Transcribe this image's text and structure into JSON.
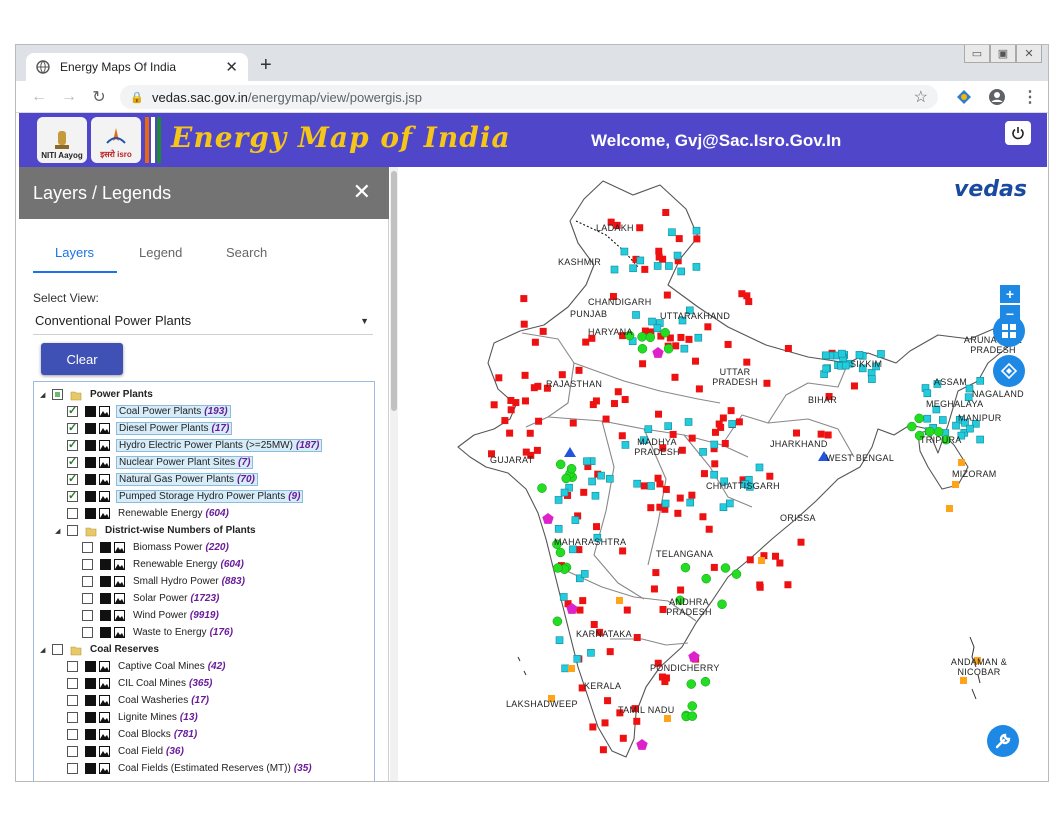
{
  "browser": {
    "tab_title": "Energy Maps Of India",
    "url_host": "vedas.sac.gov.in",
    "url_path": "/energymap/view/powergis.jsp"
  },
  "header": {
    "logo1_label": "NITI Aayog",
    "logo2_label": "इसरो isro",
    "title": "Energy Map of India",
    "welcome": "Welcome, Gvj@Sac.Isro.Gov.In"
  },
  "panel": {
    "title": "Layers / Legends",
    "tabs": [
      "Layers",
      "Legend",
      "Search"
    ],
    "select_view_label": "Select View:",
    "select_view_value": "Conventional Power Plants",
    "clear_label": "Clear",
    "tree": [
      {
        "label": "Power Plants",
        "group": true,
        "checked": "partial",
        "level": 0
      },
      {
        "label": "Coal Power Plants",
        "count": "(193)",
        "checked": true,
        "level": 1,
        "selected": true
      },
      {
        "label": "Diesel Power Plants",
        "count": "(17)",
        "checked": true,
        "level": 1,
        "selected": true
      },
      {
        "label": "Hydro Electric Power Plants (>=25MW)",
        "count": "(187)",
        "checked": true,
        "level": 1,
        "selected": true
      },
      {
        "label": "Nuclear Power Plant Sites",
        "count": "(7)",
        "checked": true,
        "level": 1,
        "selected": true
      },
      {
        "label": "Natural Gas Power Plants",
        "count": "(70)",
        "checked": true,
        "level": 1,
        "selected": true
      },
      {
        "label": "Pumped Storage Hydro Power Plants",
        "count": "(9)",
        "checked": true,
        "level": 1,
        "selected": true
      },
      {
        "label": "Renewable Energy",
        "count": "(604)",
        "checked": false,
        "level": 1
      },
      {
        "label": "District-wise Numbers of Plants",
        "group": true,
        "checked": false,
        "level": 1
      },
      {
        "label": "Biomass Power",
        "count": "(220)",
        "checked": false,
        "level": 2
      },
      {
        "label": "Renewable Energy",
        "count": "(604)",
        "checked": false,
        "level": 2
      },
      {
        "label": "Small Hydro Power",
        "count": "(883)",
        "checked": false,
        "level": 2
      },
      {
        "label": "Solar Power",
        "count": "(1723)",
        "checked": false,
        "level": 2
      },
      {
        "label": "Wind Power",
        "count": "(9919)",
        "checked": false,
        "level": 2
      },
      {
        "label": "Waste to Energy",
        "count": "(176)",
        "checked": false,
        "level": 2
      },
      {
        "label": "Coal Reserves",
        "group": true,
        "checked": false,
        "level": 0
      },
      {
        "label": "Captive Coal Mines",
        "count": "(42)",
        "checked": false,
        "level": 1
      },
      {
        "label": "CIL Coal Mines",
        "count": "(365)",
        "checked": false,
        "level": 1
      },
      {
        "label": "Coal Washeries",
        "count": "(17)",
        "checked": false,
        "level": 1
      },
      {
        "label": "Lignite Mines",
        "count": "(13)",
        "checked": false,
        "level": 1
      },
      {
        "label": "Coal Blocks",
        "count": "(781)",
        "checked": false,
        "level": 1
      },
      {
        "label": "Coal Field",
        "count": "(36)",
        "checked": false,
        "level": 1
      },
      {
        "label": "Coal Fields (Estimated Reserves (MT))",
        "count": "(35)",
        "checked": false,
        "level": 1
      }
    ]
  },
  "map": {
    "brand": "vedas",
    "region_labels": [
      "LADAKH",
      "KASHMIR",
      "CHANDIGARH",
      "PUNJAB",
      "HARYANA",
      "UTTARAKHAND",
      "RAJASTHAN",
      "UTTAR PRADESH",
      "SIKKIM",
      "ARUNACHAL PRADESH",
      "ASSAM",
      "NAGALAND",
      "MEGHALAYA",
      "MANIPUR",
      "TRIPURA",
      "MIZORAM",
      "BIHAR",
      "JHARKHAND",
      "WEST BENGAL",
      "MADHYA PRADESH",
      "GUJARAT",
      "CHHATTISGARH",
      "ORISSA",
      "MAHARASHTRA",
      "TELANGANA",
      "ANDHRA PRADESH",
      "KARNATAKA",
      "PONDICHERRY",
      "KERALA",
      "TAMIL NADU",
      "LAKSHADWEEP",
      "ANDAMAN & NICOBAR"
    ],
    "colors": {
      "coal": "#ee1111",
      "hydro": "#22ccdd",
      "gas": "#22dd22",
      "diesel": "#ffa31a",
      "nuclear": "#2255dd",
      "pumped": "#dd22cc"
    }
  }
}
